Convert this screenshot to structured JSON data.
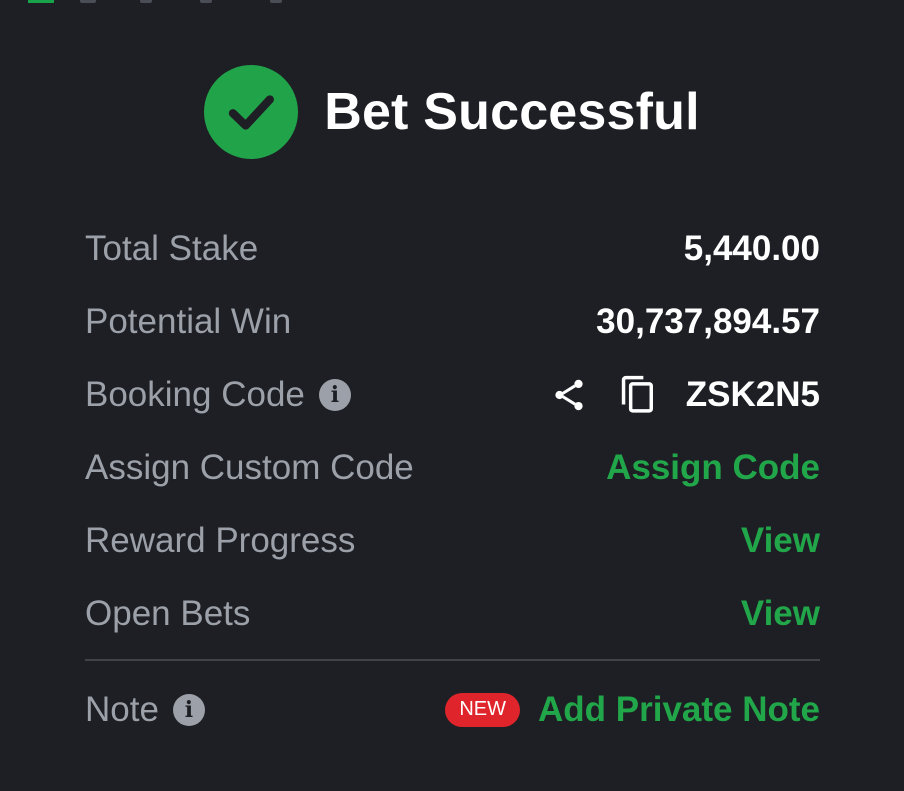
{
  "header": {
    "title": "Bet Successful",
    "icon": "check-circle-icon",
    "accent": "#21a34a"
  },
  "rows": {
    "total_stake": {
      "label": "Total Stake",
      "value": "5,440.00"
    },
    "potential_win": {
      "label": "Potential Win",
      "value": "30,737,894.57"
    },
    "booking_code": {
      "label": "Booking Code",
      "info_icon": "i",
      "value": "ZSK2N5",
      "share_icon": "share-icon",
      "copy_icon": "copy-icon"
    },
    "custom_code": {
      "label": "Assign Custom Code",
      "action": "Assign Code"
    },
    "reward_progress": {
      "label": "Reward Progress",
      "action": "View"
    },
    "open_bets": {
      "label": "Open Bets",
      "action": "View"
    }
  },
  "note": {
    "label": "Note",
    "info_icon": "i",
    "badge": "NEW",
    "action": "Add Private Note"
  },
  "colors": {
    "background": "#1d1f24",
    "label": "#9ca0a8",
    "value": "#ffffff",
    "link": "#22a64a",
    "badge": "#e0242b"
  }
}
